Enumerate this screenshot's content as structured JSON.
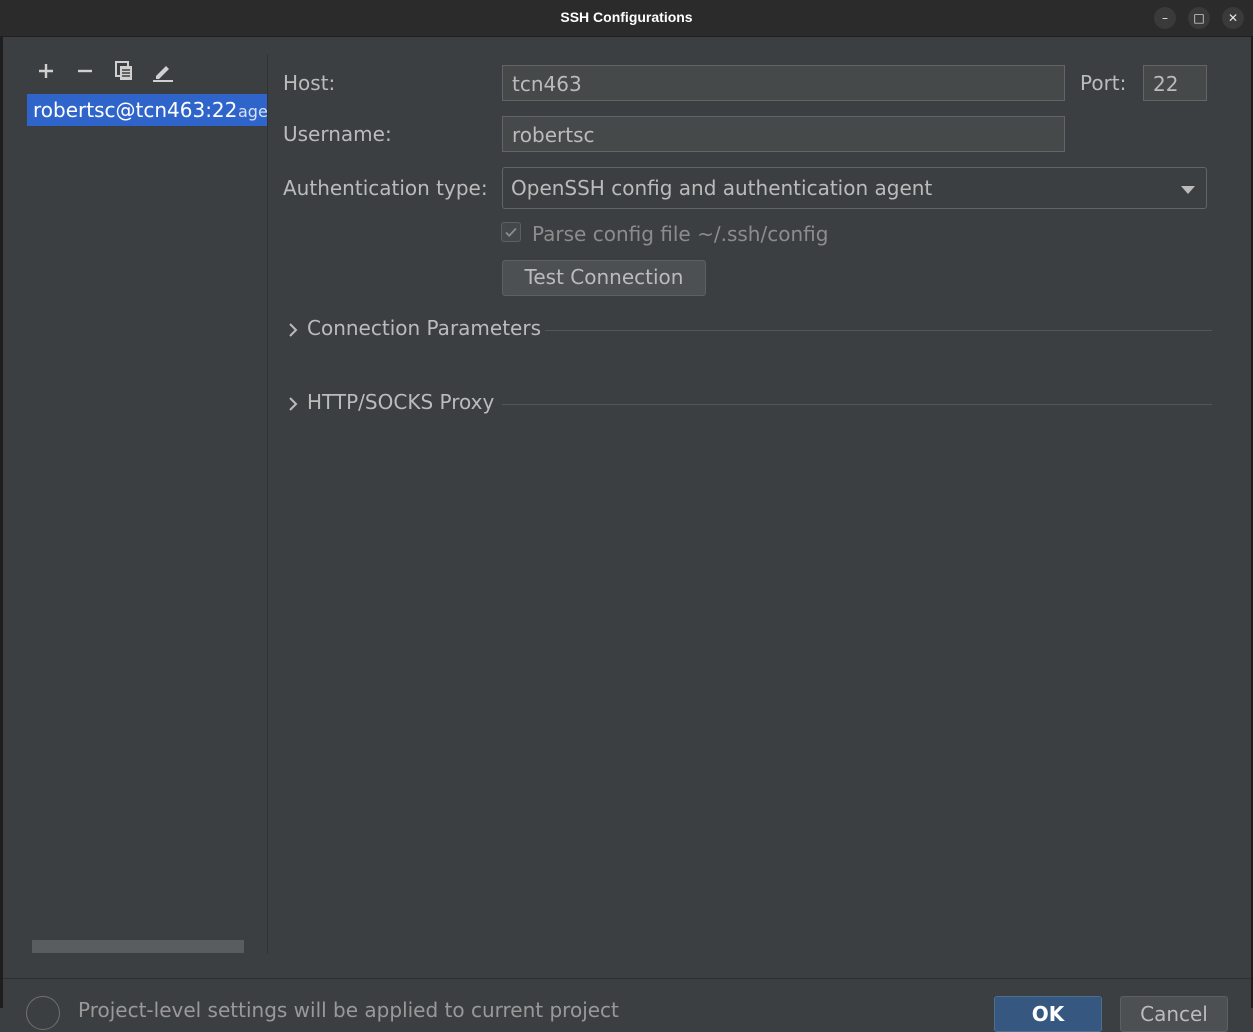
{
  "window": {
    "title": "SSH Configurations",
    "controls": {
      "minimize": "–",
      "maximize": "□",
      "close": "✕"
    }
  },
  "toolbar": {
    "icons": [
      "add-icon",
      "remove-icon",
      "copy-icon",
      "edit-icon"
    ]
  },
  "sidebar": {
    "items": [
      {
        "label": "robertsc@tcn463:22",
        "hint": "age",
        "selected": true
      }
    ]
  },
  "form": {
    "host": {
      "label": "Host:",
      "value": "tcn463"
    },
    "port": {
      "label": "Port:",
      "value": "22"
    },
    "username": {
      "label": "Username:",
      "value": "robertsc"
    },
    "auth": {
      "label": "Authentication type:",
      "value": "OpenSSH config and authentication agent"
    },
    "parse_config": {
      "label": "Parse config file ~/.ssh/config",
      "checked": true,
      "enabled": false
    },
    "test_button": "Test Connection"
  },
  "sections": {
    "connection_parameters": "Connection Parameters",
    "proxy": "HTTP/SOCKS Proxy"
  },
  "footer": {
    "text": "Project-level settings will be applied to current project",
    "ok": "OK",
    "cancel": "Cancel"
  },
  "colors": {
    "background": "#3c3f41",
    "selection": "#2f65ca",
    "accent_button": "#365880"
  }
}
